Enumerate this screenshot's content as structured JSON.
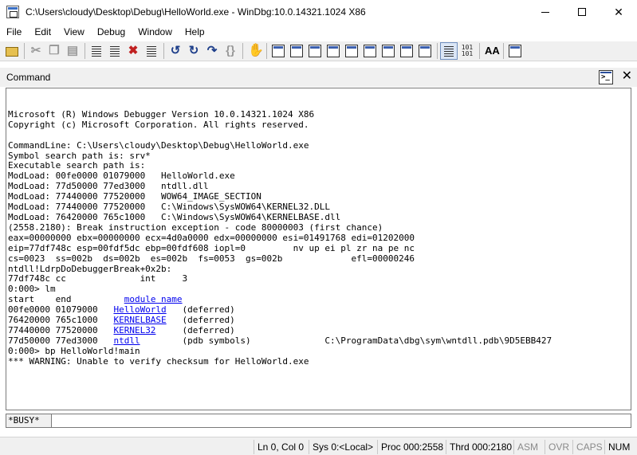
{
  "window": {
    "title": "C:\\Users\\cloudy\\Desktop\\Debug\\HelloWorld.exe - WinDbg:10.0.14321.1024 X86",
    "minimize_glyph": "",
    "close_glyph": "✕"
  },
  "menu": [
    {
      "label": "File"
    },
    {
      "label": "Edit"
    },
    {
      "label": "View"
    },
    {
      "label": "Debug"
    },
    {
      "label": "Window"
    },
    {
      "label": "Help"
    }
  ],
  "toolbar": {
    "text_icon_1": "101\n101",
    "font_icon": "AA"
  },
  "command_window": {
    "title": "Command",
    "close_glyph": "✕",
    "output_lines": [
      "",
      "Microsoft (R) Windows Debugger Version 10.0.14321.1024 X86",
      "Copyright (c) Microsoft Corporation. All rights reserved.",
      "",
      "CommandLine: C:\\Users\\cloudy\\Desktop\\Debug\\HelloWorld.exe",
      "Symbol search path is: srv*",
      "Executable search path is:",
      "ModLoad: 00fe0000 01079000   HelloWorld.exe",
      "ModLoad: 77d50000 77ed3000   ntdll.dll",
      "ModLoad: 77440000 77520000   WOW64_IMAGE_SECTION",
      "ModLoad: 77440000 77520000   C:\\Windows\\SysWOW64\\KERNEL32.DLL",
      "ModLoad: 76420000 765c1000   C:\\Windows\\SysWOW64\\KERNELBASE.dll",
      "(2558.2180): Break instruction exception - code 80000003 (first chance)",
      "eax=00000000 ebx=00000000 ecx=4d0a0000 edx=00000000 esi=01491768 edi=01202000",
      "eip=77df748c esp=00fdf5dc ebp=00fdf608 iopl=0         nv up ei pl zr na pe nc",
      "cs=0023  ss=002b  ds=002b  es=002b  fs=0053  gs=002b             efl=00000246",
      "ntdll!LdrpDoDebuggerBreak+0x2b:",
      "77df748c cc              int     3",
      "0:000> lm"
    ],
    "module_table": {
      "headers": [
        "start",
        "end",
        "module name"
      ],
      "rows": [
        {
          "start": "00fe0000",
          "end": "01079000",
          "name": "HelloWorld",
          "info": "(deferred)"
        },
        {
          "start": "76420000",
          "end": "765c1000",
          "name": "KERNELBASE",
          "info": "(deferred)"
        },
        {
          "start": "77440000",
          "end": "77520000",
          "name": "KERNEL32",
          "info": "(deferred)"
        },
        {
          "start": "77d50000",
          "end": "77ed3000",
          "name": "ntdll",
          "info": "(pdb symbols)",
          "path": "C:\\ProgramData\\dbg\\sym\\wntdll.pdb\\9D5EBB427"
        }
      ]
    },
    "trailing_lines": [
      "0:000> bp HelloWorld!main",
      "*** WARNING: Unable to verify checksum for HelloWorld.exe"
    ],
    "prompt_label": "*BUSY*",
    "input_value": ""
  },
  "statusbar": {
    "position": "Ln 0, Col 0",
    "sys": "Sys 0:<Local>",
    "proc": "Proc 000:2558",
    "thrd": "Thrd 000:2180",
    "asm": "ASM",
    "ovr": "OVR",
    "caps": "CAPS",
    "num": "NUM"
  }
}
